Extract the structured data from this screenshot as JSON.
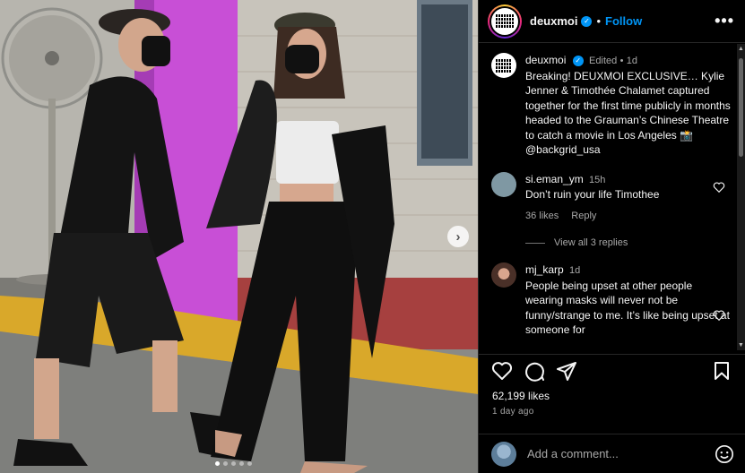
{
  "post": {
    "username": "deuxmoi",
    "follow_label": "Follow",
    "separator": "•",
    "more_label": "•••",
    "photo": {
      "slide_count": 5,
      "active_slide": 1,
      "next_arrow": "›"
    }
  },
  "caption": {
    "username": "deuxmoi",
    "edited": "Edited",
    "separator": "•",
    "time": "1d",
    "text": "Breaking! DEUXMOI EXCLUSIVE… Kylie Jenner & Timothée Chalamet captured together for the first time publicly in months headed to the Grauman’s Chinese Theatre to catch a movie in Los Angeles 📸 @backgrid_usa"
  },
  "comments": [
    {
      "username": "si.eman_ym",
      "time": "15h",
      "text": "Don’t ruin your life Timothee",
      "likes": "36 likes",
      "reply_label": "Reply",
      "view_replies": "View all 3 replies",
      "avatar_color": "#7f98a3"
    },
    {
      "username": "mj_karp",
      "time": "1d",
      "text": "People being upset at other people wearing masks will never not be funny/strange to me. It’s like being upset at someone for",
      "avatar_color": "#6b4f45"
    }
  ],
  "engagement": {
    "likes": "62,199 likes",
    "posted": "1 day ago"
  },
  "comment_box": {
    "placeholder": "Add a comment..."
  },
  "icons": [
    "verified-icon",
    "more-icon",
    "heart-icon",
    "comment-icon",
    "share-icon",
    "bookmark-icon",
    "emoji-icon",
    "chevron-right-icon"
  ],
  "colors": {
    "background": "#000000",
    "link_blue": "#0095f6",
    "muted_text": "#a8a8a8",
    "divider": "#262626"
  }
}
